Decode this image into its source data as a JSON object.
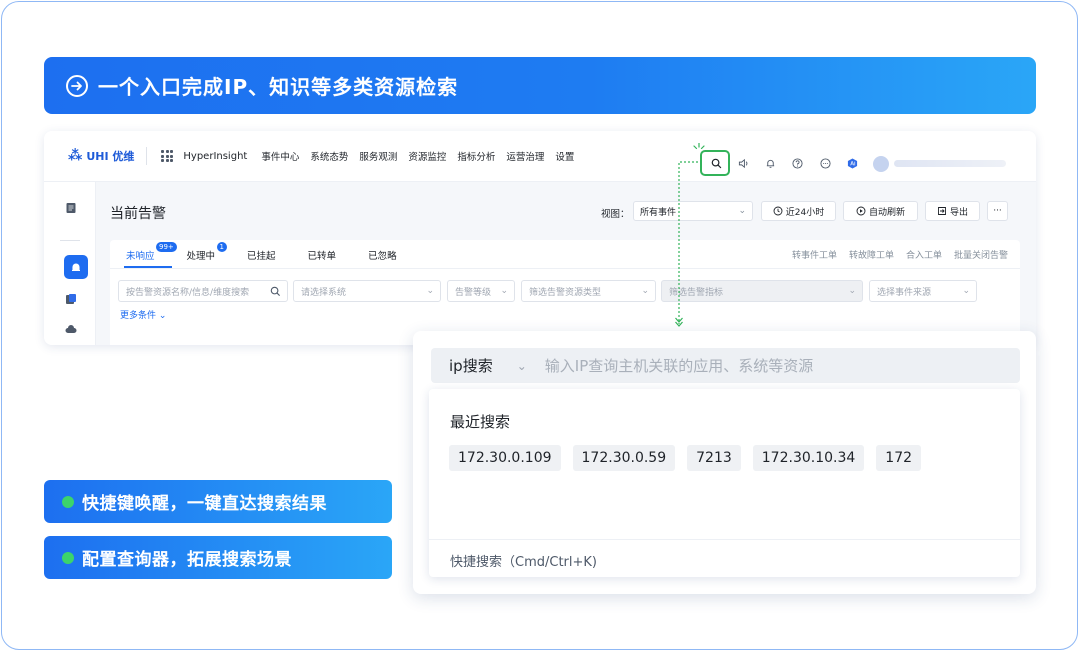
{
  "headline": {
    "title": "一个入口完成IP、知识等多类资源检索"
  },
  "app": {
    "logo_text": "UHI 优维",
    "brand": "HyperInsight",
    "nav": [
      "事件中心",
      "系统态势",
      "服务观测",
      "资源监控",
      "指标分析",
      "运营治理",
      "设置"
    ],
    "page_title": "当前告警",
    "view_label": "视图：",
    "view_value": "所有事件",
    "time_button": "近24小时",
    "refresh_button": "自动刷新",
    "export_button": "导出",
    "more_button": "···",
    "tabs": [
      {
        "label": "未响应",
        "badge": "99+"
      },
      {
        "label": "处理中",
        "badge": "1"
      },
      {
        "label": "已挂起"
      },
      {
        "label": "已转单"
      },
      {
        "label": "已忽略"
      }
    ],
    "tab_actions": [
      "转事件工单",
      "转故障工单",
      "合入工单",
      "批量关闭告警"
    ],
    "filters": {
      "keyword": "按告警资源名称/信息/维度搜索",
      "system": "请选择系统",
      "level": "告警等级",
      "resource_type": "筛选告警资源类型",
      "metric": "筛选告警指标",
      "source": "选择事件来源"
    },
    "more_conditions": "更多条件"
  },
  "popup": {
    "search_type": "ip搜索",
    "placeholder": "输入IP查询主机关联的应用、系统等资源",
    "recent_title": "最近搜索",
    "recent": [
      "172.30.0.109",
      "172.30.0.59",
      "7213",
      "172.30.10.34",
      "172"
    ],
    "shortcut": "快捷搜索（Cmd/Ctrl+K)"
  },
  "features": [
    "快捷键唤醒，一键直达搜索结果",
    "配置查询器，拓展搜索场景"
  ],
  "colors": {
    "accent": "#1e6cf0",
    "highlight": "#33b35a",
    "dot": "#3cd46b"
  }
}
